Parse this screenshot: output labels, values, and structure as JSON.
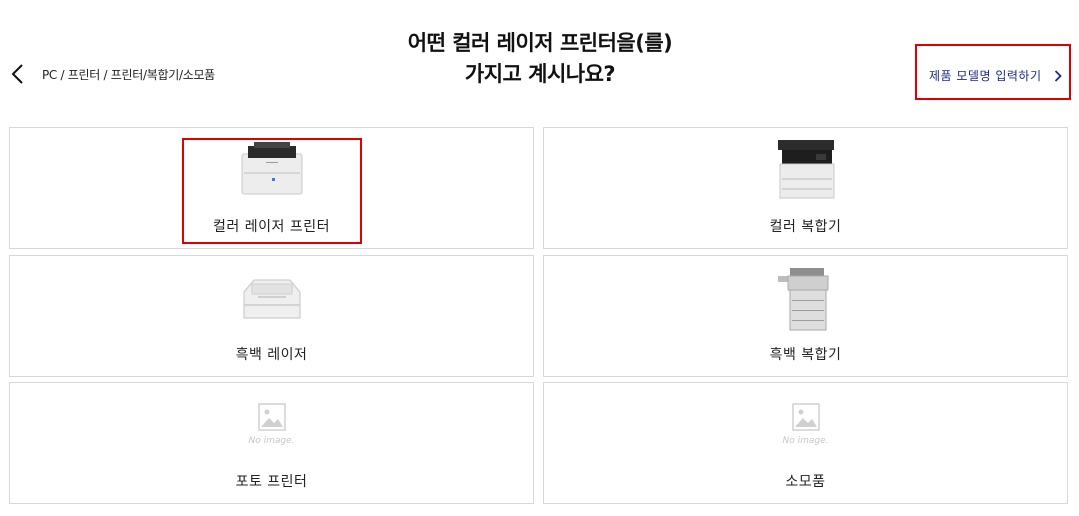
{
  "header": {
    "breadcrumb": "PC / 프린터 / 프린터/복합기/소모품",
    "title_line1": "어떤 컬러 레이저 프린터을(를)",
    "title_line2": "가지고 계시나요?",
    "model_link_label": "제품 모델명 입력하기"
  },
  "cards": [
    {
      "label": "컬러 레이저 프린터",
      "image": "color-laser-printer"
    },
    {
      "label": "컬러 복합기",
      "image": "color-multifunction"
    },
    {
      "label": "흑백 레이저",
      "image": "mono-laser-printer"
    },
    {
      "label": "흑백 복합기",
      "image": "mono-multifunction"
    },
    {
      "label": "포토 프린터",
      "image": "no-image",
      "no_image_text": "No image."
    },
    {
      "label": "소모품",
      "image": "no-image",
      "no_image_text": "No image."
    }
  ],
  "colors": {
    "highlight": "#e00000",
    "link": "#1a2a8a",
    "border": "#d8d8d8"
  }
}
